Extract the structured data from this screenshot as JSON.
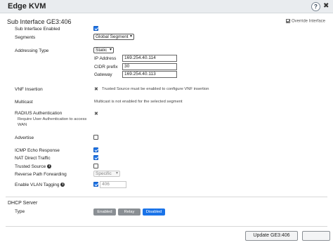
{
  "window": {
    "title": "Edge KVM",
    "help": "?",
    "close": "✖"
  },
  "section_title": "Sub Interface GE3:406",
  "override": "Override Interface",
  "sub_interface_enabled": {
    "label": "Sub Interface Enabled",
    "checked": true
  },
  "segments": {
    "label": "Segments",
    "value": "Global Segment"
  },
  "addressing": {
    "label": "Addressing Type",
    "type": "Static",
    "ip_label": "IP Address",
    "ip_value": "169.254.40.114",
    "cidr_label": "CIDR prefix",
    "cidr_value": "30",
    "gateway_label": "Gateway",
    "gateway_value": "169.254.40.113"
  },
  "vnf": {
    "label": "VNF Insertion",
    "note": "Trusted Source must be enabled to configure VNF insertion"
  },
  "multicast": {
    "label": "Multicast",
    "note": "Multicast is not enabled for the selected segment"
  },
  "radius": {
    "label": "RADIUS Authentication",
    "sublabel": "Require User Authentication to access WAN"
  },
  "advertise": {
    "label": "Advertise",
    "checked": false
  },
  "icmp": {
    "label": "ICMP Echo Response",
    "checked": true
  },
  "nat": {
    "label": "NAT Direct Traffic",
    "checked": true
  },
  "trusted": {
    "label": "Trusted Source",
    "checked": false
  },
  "rpf": {
    "label": "Reverse Path Forwarding",
    "value": "Specific"
  },
  "vlan": {
    "label": "Enable VLAN Tagging",
    "checked": true,
    "value": "406"
  },
  "dhcp": {
    "title": "DHCP Server",
    "type_label": "Type",
    "options": [
      "Enabled",
      "Relay",
      "Disabled"
    ],
    "selected": "Disabled"
  },
  "footer": {
    "update_label": "Update GE3:406"
  },
  "icons": {
    "info": "i",
    "x": "✖",
    "dropdown": "▾"
  },
  "colors": {
    "accent": "#1a73e8",
    "segment_inactive": "#8a8f94",
    "titlebar": "#e9ecef"
  }
}
